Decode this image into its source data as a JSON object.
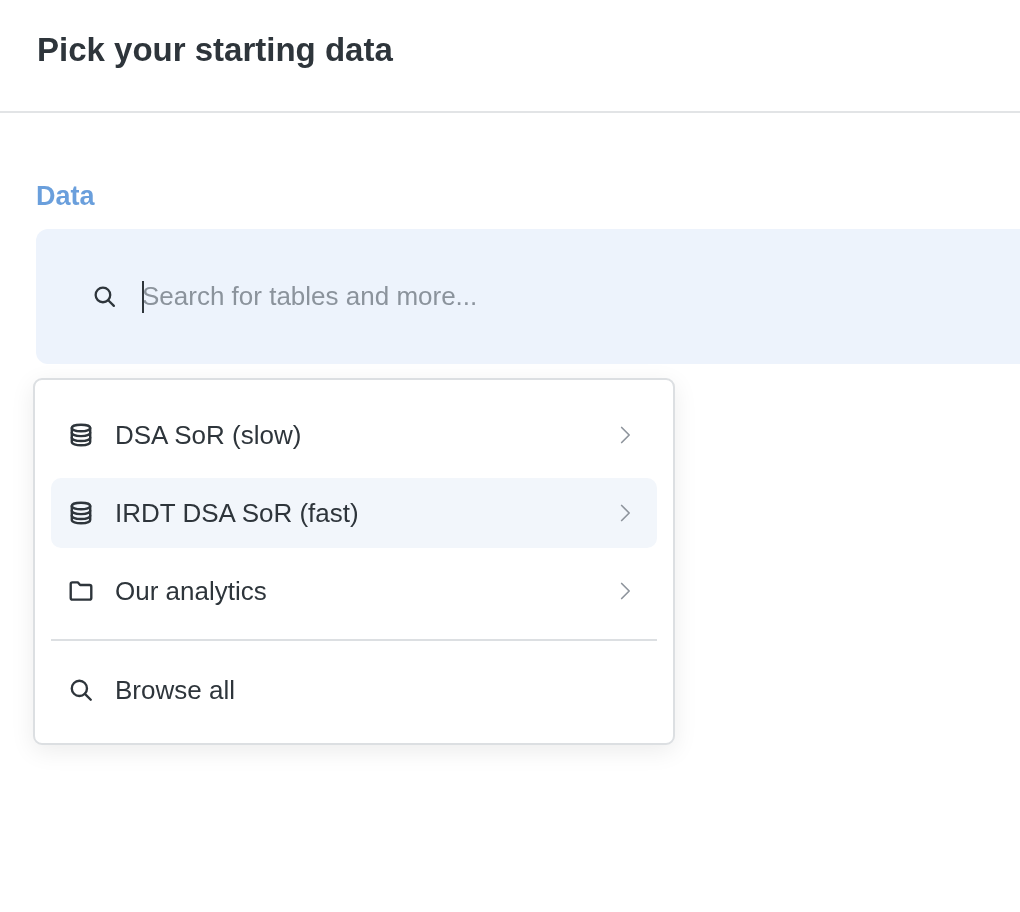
{
  "header": {
    "title": "Pick your starting data"
  },
  "data_section": {
    "label": "Data",
    "search": {
      "placeholder": "Search for tables and more...",
      "focused": true
    }
  },
  "menu": {
    "items": [
      {
        "kind": "database",
        "label": "DSA SoR (slow)",
        "selected": false,
        "has_submenu": true
      },
      {
        "kind": "database",
        "label": "IRDT DSA SoR (fast)",
        "selected": true,
        "has_submenu": true
      },
      {
        "kind": "folder",
        "label": "Our analytics",
        "selected": false,
        "has_submenu": true
      }
    ],
    "footer_items": [
      {
        "kind": "search",
        "label": "Browse all",
        "selected": false,
        "has_submenu": false
      }
    ]
  }
}
